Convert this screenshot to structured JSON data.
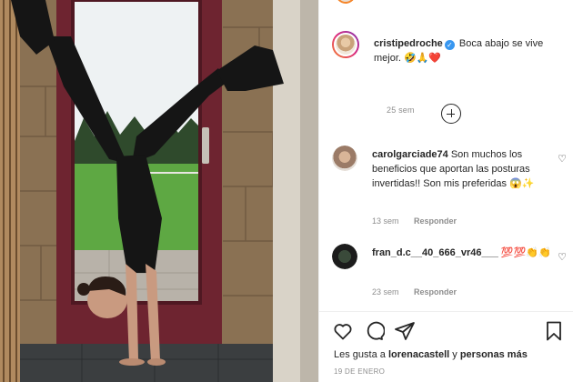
{
  "post": {
    "username": "cristipedroche",
    "caption": "Boca abajo se vive mejor.",
    "caption_emojis": "🤣🙏❤️",
    "time_ago": "25 sem",
    "likes_prefix": "Les gusta a",
    "likes_user": "lorenacastell",
    "likes_connector": "y",
    "likes_others": "personas más",
    "date": "19 DE ENERO"
  },
  "comments": [
    {
      "username": "carolgarciade74",
      "text": "Son muchos los beneficios que aportan las posturas invertidas!! Son mis preferidas",
      "emojis": "😱✨",
      "time_ago": "13 sem",
      "reply_label": "Responder"
    },
    {
      "username": "fran_d.c__40_666_vr46___",
      "text": "",
      "emojis": "💯💯👏👏",
      "time_ago": "23 sem",
      "reply_label": "Responder"
    }
  ],
  "icons": {
    "verified": "verified-badge-icon",
    "like": "heart-icon",
    "comment": "comment-icon",
    "share": "paper-plane-icon",
    "save": "bookmark-icon",
    "add_comment": "plus-circle-icon"
  },
  "colors": {
    "verified_blue": "#3897f0",
    "muted_text": "#8e8e8e",
    "primary_text": "#262626"
  }
}
